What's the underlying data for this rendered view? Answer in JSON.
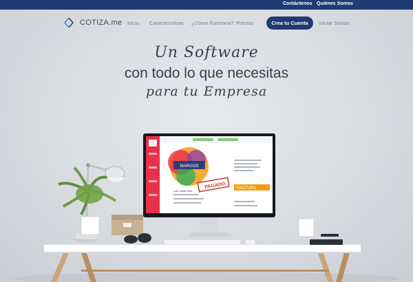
{
  "topbar": {
    "contact": "Contáctenos",
    "about": "Quiénes Somos"
  },
  "brand": {
    "name": "COTIZA.me",
    "logo_icon": "chevrons-logo-icon"
  },
  "nav": {
    "items": [
      "Inicio",
      "Características",
      "¿Cómo Funciona?",
      "Precios"
    ],
    "cta": "Crea tu Cuenta",
    "login": "Iniciar Sesión"
  },
  "hero": {
    "line1": "Un Software",
    "line2": "con todo lo que necesitas",
    "line3": "para tu Empresa"
  },
  "screen": {
    "stamp": "PAGADO",
    "factura": "FACTURA",
    "logo_text": "MARGOS",
    "client": "Luis Carlos Perez"
  },
  "colors": {
    "navy": "#1f3b73",
    "accent_red": "#e8304a",
    "orange": "#f39c12"
  }
}
